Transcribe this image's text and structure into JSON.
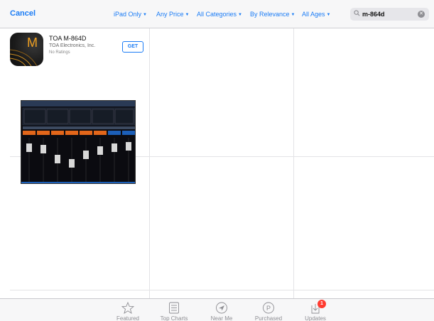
{
  "header": {
    "cancel_label": "Cancel",
    "filters": [
      {
        "label": "iPad Only"
      },
      {
        "label": "Any Price"
      },
      {
        "label": "All Categories"
      },
      {
        "label": "By Relevance"
      },
      {
        "label": "All Ages"
      }
    ],
    "search": {
      "query": "m-864d"
    }
  },
  "results": [
    {
      "name": "TOA M-864D",
      "developer": "TOA Electronics, Inc.",
      "rating_text": "No Ratings",
      "button_label": "GET",
      "icon_letter": "M"
    }
  ],
  "tabbar": {
    "tabs": [
      {
        "label": "Featured",
        "icon": "star-icon"
      },
      {
        "label": "Top Charts",
        "icon": "list-icon"
      },
      {
        "label": "Near Me",
        "icon": "location-icon"
      },
      {
        "label": "Purchased",
        "icon": "purchased-icon"
      },
      {
        "label": "Updates",
        "icon": "updates-icon",
        "badge": "1"
      }
    ]
  },
  "colors": {
    "accent": "#1b7cf5",
    "tab_inactive": "#8e8e93",
    "badge": "#ff3b30"
  }
}
